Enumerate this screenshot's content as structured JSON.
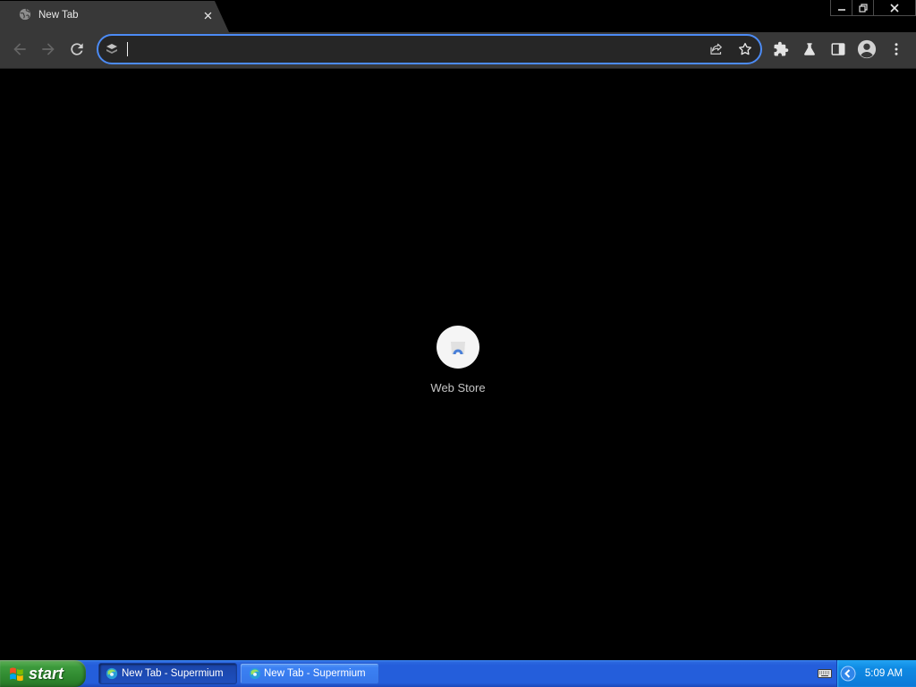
{
  "browser": {
    "tab": {
      "title": "New Tab",
      "favicon": "globe-icon",
      "close_icon": "close-icon"
    },
    "window_controls": {
      "minimize": "minimize-icon",
      "restore": "restore-icon",
      "close": "close-icon"
    },
    "toolbar": {
      "back": {
        "icon": "arrow-left-icon",
        "enabled": false
      },
      "forward": {
        "icon": "arrow-right-icon",
        "enabled": false
      },
      "reload": {
        "icon": "reload-icon",
        "enabled": true
      },
      "omnibox": {
        "value": "",
        "focused": true,
        "leading_icon": "supermium-icon",
        "share_icon": "share-icon",
        "bookmark_icon": "star-outline-icon"
      },
      "actions": [
        "puzzle-icon",
        "flask-icon",
        "side-panel-icon",
        "profile-avatar-icon",
        "kebab-menu-icon"
      ]
    },
    "new_tab_page": {
      "shortcuts": [
        {
          "label": "Web Store",
          "icon": "web-store-icon"
        }
      ]
    }
  },
  "taskbar": {
    "start_label": "start",
    "start_icon": "windows-logo-icon",
    "windows": [
      {
        "label": "New Tab - Supermium",
        "icon": "supermium-icon",
        "active": true
      },
      {
        "label": "New Tab - Supermium",
        "icon": "supermium-icon",
        "active": false
      }
    ],
    "tray": {
      "icons": [
        "keyboard-icon",
        "chevron-left-icon"
      ],
      "time": "5:09 AM"
    }
  },
  "colors": {
    "toolbar_bg": "#383838",
    "omnibox_focus_border": "#4c8bf5",
    "content_bg": "#000000",
    "taskbar_blue": "#245edb",
    "start_green": "#3c9a3c",
    "tray_blue": "#0f8ae3"
  }
}
